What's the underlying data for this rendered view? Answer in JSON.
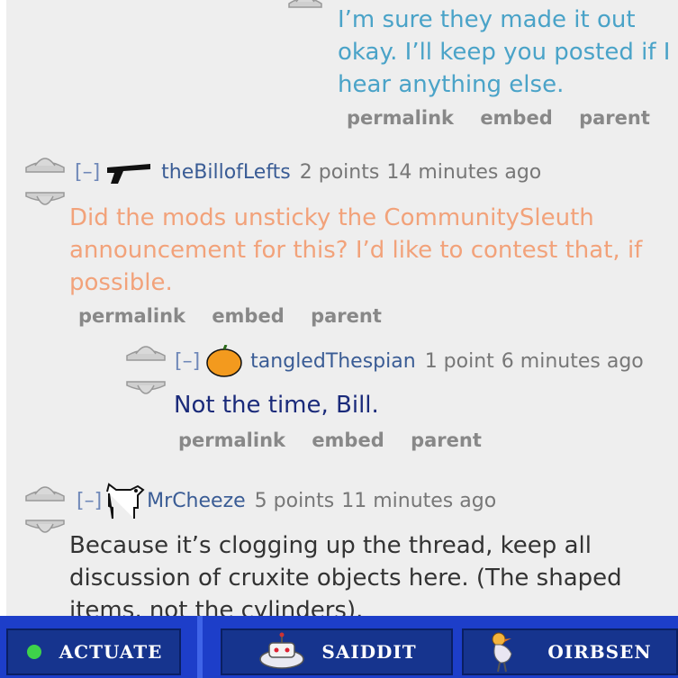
{
  "comments": [
    {
      "text": "I’m sure they made it out okay. I’ll keep you posted if I hear anything else.",
      "text_color": "#4aa3c8",
      "links": [
        "permalink",
        "embed",
        "parent"
      ]
    },
    {
      "collapse": "[–]",
      "author": "theBillofLefts",
      "points": "2 points",
      "time": "14 minutes ago",
      "avatar_icon": "gun-icon",
      "text": "Did the mods unsticky the CommunitySleuth announcement for this? I’d like to contest that, if possible.",
      "text_color": "#f2a27a",
      "links": [
        "permalink",
        "embed",
        "parent"
      ]
    },
    {
      "collapse": "[–]",
      "author": "tangledThespian",
      "points": "1 point",
      "time": "6 minutes ago",
      "avatar_icon": "pumpkin-icon",
      "text": "Not the time, Bill.",
      "text_color": "#1a2a7a",
      "links": [
        "permalink",
        "embed",
        "parent"
      ]
    },
    {
      "collapse": "[–]",
      "author": "MrCheeze",
      "points": "5 points",
      "time": "11 minutes ago",
      "avatar_icon": "dog-icon",
      "text": "Because it’s clogging up the thread, keep all discussion of cruxite objects here. (The shaped items, not the cylinders).",
      "text_color": "#333333"
    }
  ],
  "taskbar": {
    "buttons": [
      {
        "label": "ACTUATE",
        "icon": "green-dot-icon"
      },
      {
        "label": "SAIDDIT",
        "icon": "robot-icon"
      },
      {
        "label": "OIRBSEN",
        "icon": "bird-icon"
      }
    ]
  }
}
